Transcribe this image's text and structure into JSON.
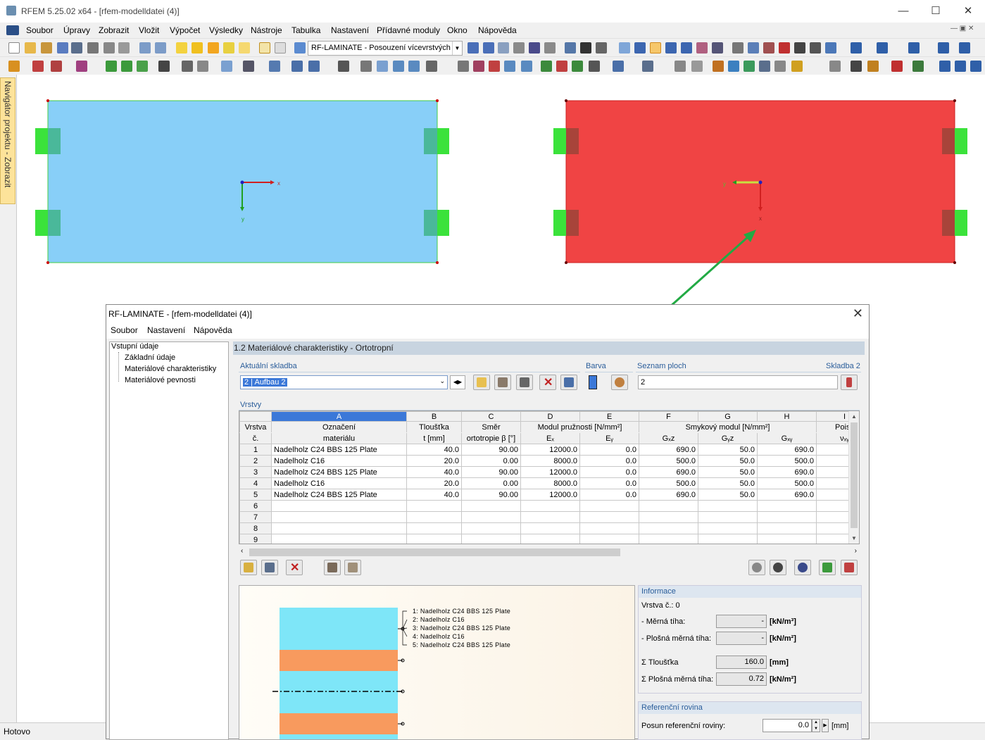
{
  "app": {
    "title": "RFEM 5.25.02 x64 - [rfem-modelldatei (4)]",
    "menu": [
      "Soubor",
      "Úpravy",
      "Zobrazit",
      "Vložit",
      "Výpočet",
      "Výsledky",
      "Nástroje",
      "Tabulka",
      "Nastavení",
      "Přídavné moduly",
      "Okno",
      "Nápověda"
    ],
    "module_combo": "RF-LAMINATE - Posouzení vícevrstvých",
    "navigator_tab": "Navigátor projektu - Zobrazit",
    "status": "Hotovo",
    "colors": {
      "surface1": "#88cff8",
      "surface2": "#f04444",
      "support": "#3be23b",
      "arrow": "#22aa44"
    }
  },
  "model": {
    "surface1_axes": {
      "x": "x",
      "y": "y"
    },
    "surface2_axes": {
      "x": "x",
      "y": "y"
    }
  },
  "dialog": {
    "title": "RF-LAMINATE - [rfem-modelldatei (4)]",
    "menu": [
      "Soubor",
      "Nastavení",
      "Nápověda"
    ],
    "tree": {
      "root": "Vstupní údaje",
      "items": [
        "Základní údaje",
        "Materiálové charakteristiky",
        "Materiálové pevnosti"
      ]
    },
    "section_title": "1.2 Materiálové charakteristiky - Ortotropní",
    "current_layup_label": "Aktuální skladba",
    "current_layup_value": "2 | Aufbau 2",
    "color_label": "Barva",
    "surface_list_label": "Seznam ploch",
    "layup_name": "Skladba 2",
    "surface_list_value": "2",
    "layers_label": "Vrstvy",
    "grid": {
      "letters": [
        "A",
        "B",
        "C",
        "D",
        "E",
        "F",
        "G",
        "H",
        "I"
      ],
      "h_row": "Vrstva",
      "h_row2": "č.",
      "h_a1": "Označení",
      "h_a2": "materiálu",
      "h_b1": "Tloušťka",
      "h_b2": "t [mm]",
      "h_c1": "Směr",
      "h_c2": "ortotropie β [°]",
      "h_de1": "Modul pružnosti [N/mm²]",
      "h_d2": "Eₓ",
      "h_e2": "Eᵧ",
      "h_fgh1": "Smykový modul [N/mm²]",
      "h_f2": "Gₓz",
      "h_g2": "Gᵧz",
      "h_h2": "Gₓᵧ",
      "h_i1": "Poiss",
      "h_i2": "νₓᵧ",
      "rows": [
        {
          "no": "1",
          "material": "Nadelholz C24 BBS 125 Plate",
          "t": "40.0",
          "beta": "90.00",
          "ex": "12000.0",
          "ey": "0.0",
          "gxz": "690.0",
          "gyz": "50.0",
          "gxy": "690.0"
        },
        {
          "no": "2",
          "material": "Nadelholz C16",
          "t": "20.0",
          "beta": "0.00",
          "ex": "8000.0",
          "ey": "0.0",
          "gxz": "500.0",
          "gyz": "50.0",
          "gxy": "500.0"
        },
        {
          "no": "3",
          "material": "Nadelholz C24 BBS 125 Plate",
          "t": "40.0",
          "beta": "90.00",
          "ex": "12000.0",
          "ey": "0.0",
          "gxz": "690.0",
          "gyz": "50.0",
          "gxy": "690.0"
        },
        {
          "no": "4",
          "material": "Nadelholz C16",
          "t": "20.0",
          "beta": "0.00",
          "ex": "8000.0",
          "ey": "0.0",
          "gxz": "500.0",
          "gyz": "50.0",
          "gxy": "500.0"
        },
        {
          "no": "5",
          "material": "Nadelholz C24 BBS 125 Plate",
          "t": "40.0",
          "beta": "90.00",
          "ex": "12000.0",
          "ey": "0.0",
          "gxz": "690.0",
          "gyz": "50.0",
          "gxy": "690.0"
        },
        {
          "no": "6",
          "material": "",
          "t": "",
          "beta": "",
          "ex": "",
          "ey": "",
          "gxz": "",
          "gyz": "",
          "gxy": ""
        },
        {
          "no": "7",
          "material": "",
          "t": "",
          "beta": "",
          "ex": "",
          "ey": "",
          "gxz": "",
          "gyz": "",
          "gxy": ""
        },
        {
          "no": "8",
          "material": "",
          "t": "",
          "beta": "",
          "ex": "",
          "ey": "",
          "gxz": "",
          "gyz": "",
          "gxy": ""
        },
        {
          "no": "9",
          "material": "",
          "t": "",
          "beta": "",
          "ex": "",
          "ey": "",
          "gxz": "",
          "gyz": "",
          "gxy": ""
        }
      ]
    },
    "preview_labels": [
      "1: Nadelholz C24 BBS 125 Plate",
      "2: Nadelholz C16",
      "3: Nadelholz C24 BBS 125 Plate",
      "4: Nadelholz C16",
      "5: Nadelholz C24 BBS 125 Plate"
    ],
    "preview_colors": {
      "c24": "#7ee6f8",
      "c16": "#f89a5e"
    },
    "info": {
      "title": "Informace",
      "layer_no": "Vrstva č.: 0",
      "specific_weight_label": "- Měrná tíha:",
      "specific_weight_value": "-",
      "specific_weight_unit": "[kN/m³]",
      "area_weight_label": "- Plošná měrná tíha:",
      "area_weight_value": "-",
      "area_weight_unit": "[kN/m²]",
      "sum_thickness_label": "Σ Tloušťka",
      "sum_thickness_value": "160.0",
      "sum_thickness_unit": "[mm]",
      "sum_area_weight_label": "Σ Plošná měrná tíha:",
      "sum_area_weight_value": "0.72",
      "sum_area_weight_unit": "[kN/m²]"
    },
    "ref_plane": {
      "title": "Referenční rovina",
      "offset_label": "Posun referenční roviny:",
      "offset_value": "0.0",
      "offset_unit": "[mm]"
    }
  }
}
